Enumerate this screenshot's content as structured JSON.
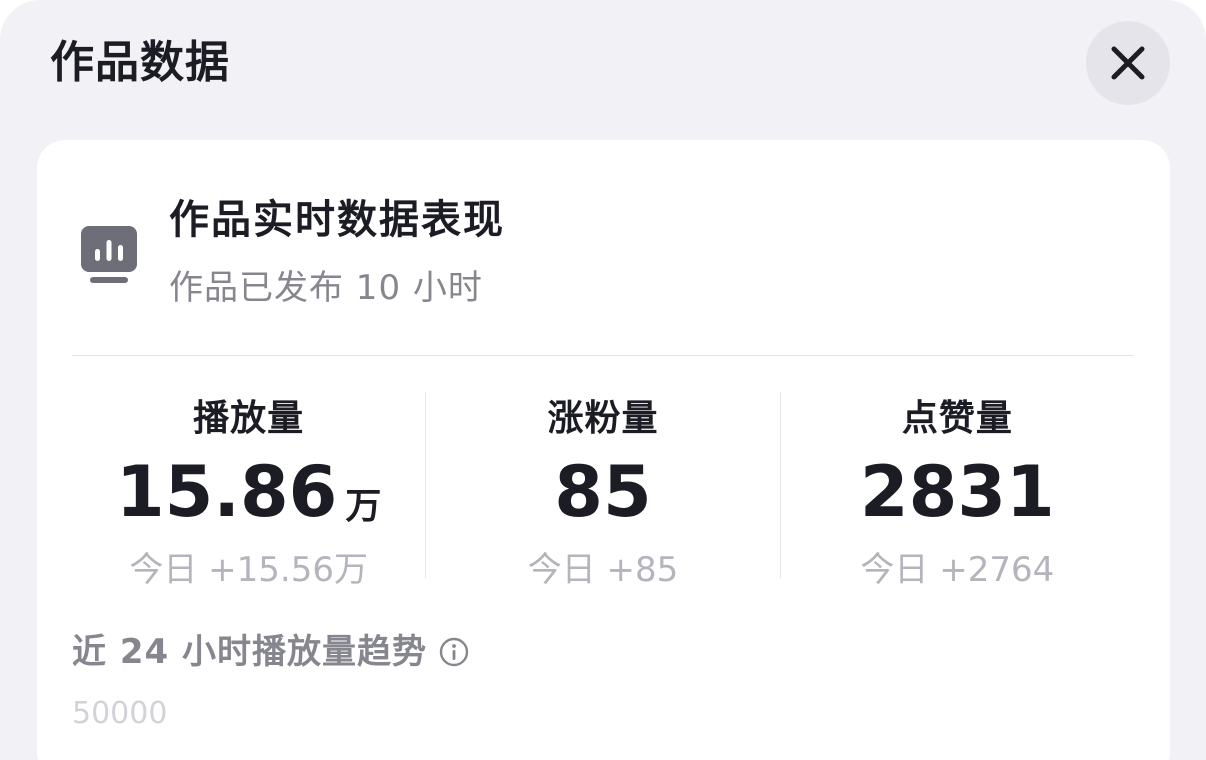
{
  "sheet": {
    "title": "作品数据",
    "close_icon": "close-icon"
  },
  "card": {
    "icon": "bar-chart-monitor-icon",
    "title": "作品实时数据表现",
    "subtitle": "作品已发布 10 小时"
  },
  "stats": [
    {
      "label": "播放量",
      "value": "15.86",
      "unit": "万",
      "today": "今日 +15.56万"
    },
    {
      "label": "涨粉量",
      "value": "85",
      "unit": "",
      "today": "今日 +85"
    },
    {
      "label": "点赞量",
      "value": "2831",
      "unit": "",
      "today": "今日 +2764"
    }
  ],
  "trend": {
    "title": "近 24 小时播放量趋势",
    "info_icon": "info-icon",
    "axis_top_label": "50000"
  },
  "colors": {
    "sheet_bg": "#f2f2f6",
    "card_bg": "#ffffff",
    "primary_text": "#1c1c24",
    "secondary_text": "#86868e",
    "muted_text": "#b4b4bc"
  }
}
